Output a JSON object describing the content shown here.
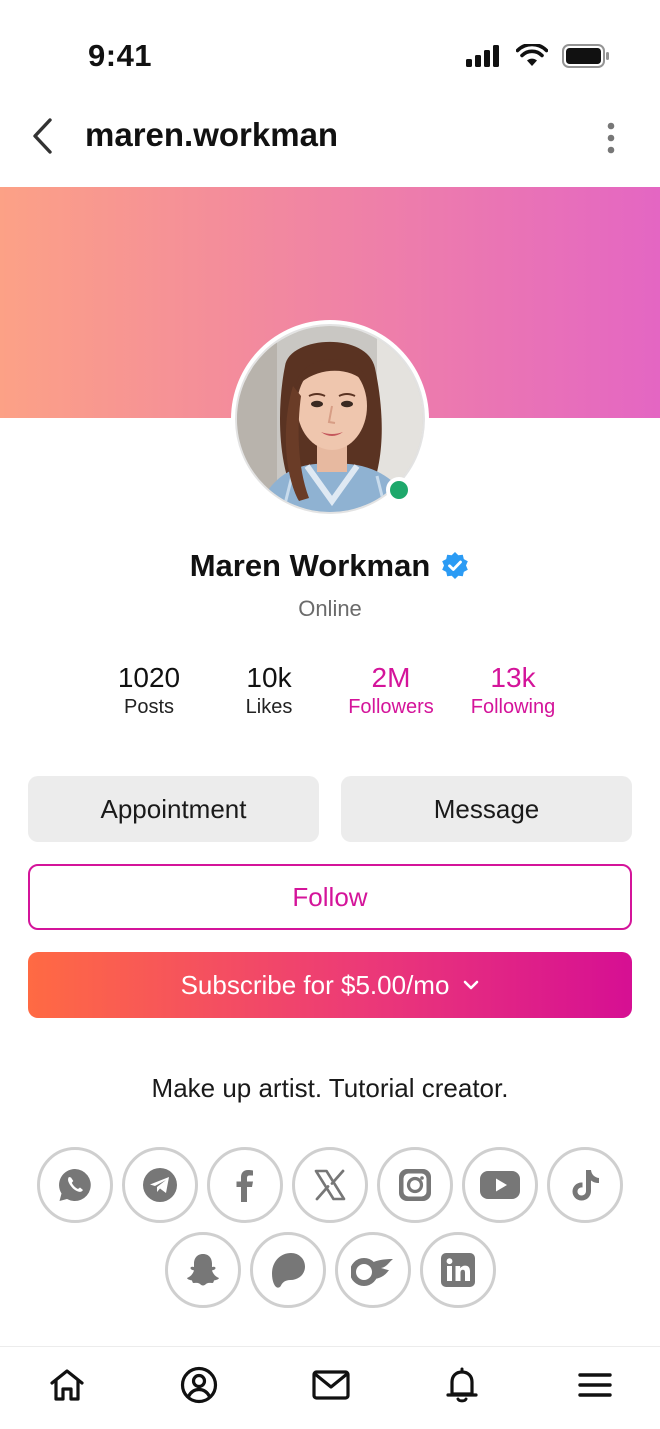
{
  "status_bar": {
    "time": "9:41",
    "icons": [
      "cellular-signal-icon",
      "wifi-icon",
      "battery-icon"
    ]
  },
  "nav": {
    "title": "maren.workman",
    "icons": [
      "back-chevron-icon",
      "more-vertical-icon"
    ]
  },
  "cover": {
    "gradient_start": "#fca186",
    "gradient_end": "#e466c3"
  },
  "profile": {
    "name": "Maren Workman",
    "verified": true,
    "status": "Online",
    "online_color": "#1ea86b",
    "verified_color": "#2b9bf4"
  },
  "stats": [
    {
      "value": "1020",
      "label": "Posts",
      "accent": false
    },
    {
      "value": "10k",
      "label": "Likes",
      "accent": false
    },
    {
      "value": "2M",
      "label": "Followers",
      "accent": true
    },
    {
      "value": "13k",
      "label": "Following",
      "accent": true
    }
  ],
  "actions": {
    "appointment_label": "Appointment",
    "message_label": "Message",
    "follow_label": "Follow",
    "subscribe_label": "Subscribe for $5.00/mo"
  },
  "bio": "Make up artist. Tutorial creator.",
  "social_links": [
    "whatsapp-icon",
    "telegram-icon",
    "facebook-icon",
    "x-icon",
    "instagram-icon",
    "youtube-icon",
    "tiktok-icon",
    "snapchat-icon",
    "patreon-icon",
    "onlyfans-icon",
    "linkedin-icon"
  ],
  "tab_bar": [
    "home-icon",
    "profile-icon",
    "mail-icon",
    "bell-icon",
    "menu-icon"
  ],
  "colors": {
    "accent": "#d4149a",
    "subscribe_start": "#ff6a43",
    "subscribe_end": "#d60f93",
    "button_grey": "#ececec",
    "social_icon": "#7a7a7a"
  }
}
